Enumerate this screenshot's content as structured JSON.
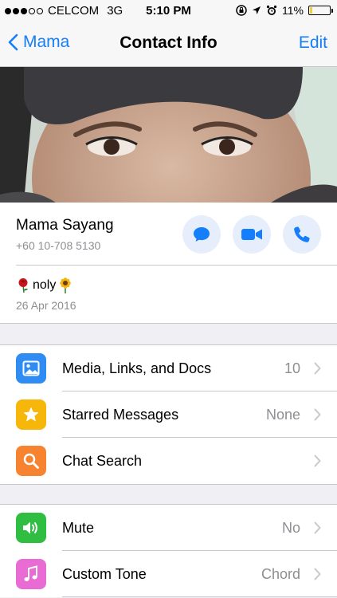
{
  "status_bar": {
    "carrier": "CELCOM",
    "network": "3G",
    "time": "5:10 PM",
    "battery_percent": "11%",
    "battery_level": 0.11,
    "signal_bars_filled": 3,
    "signal_bars_total": 5
  },
  "nav": {
    "back_label": "Mama",
    "title": "Contact Info",
    "edit_label": "Edit"
  },
  "contact": {
    "name": "Mama Sayang",
    "phone": "+60 10-708 5130",
    "status_text": "noly",
    "status_date": "26 Apr 2016"
  },
  "group1": [
    {
      "label": "Media, Links, and Docs",
      "value": "10",
      "icon": "photo-icon",
      "color": "#2f8cf3"
    },
    {
      "label": "Starred Messages",
      "value": "None",
      "icon": "star-icon",
      "color": "#f6b60a"
    },
    {
      "label": "Chat Search",
      "value": "",
      "icon": "search-icon",
      "color": "#f7822f"
    }
  ],
  "group2": [
    {
      "label": "Mute",
      "value": "No",
      "icon": "speaker-icon",
      "color": "#2fbe41"
    },
    {
      "label": "Custom Tone",
      "value": "Chord",
      "icon": "music-note-icon",
      "color": "#e86cd4"
    }
  ],
  "colors": {
    "accent": "#157efb",
    "action_bg": "#e6eefc",
    "battery_fill": "#f4d131"
  }
}
